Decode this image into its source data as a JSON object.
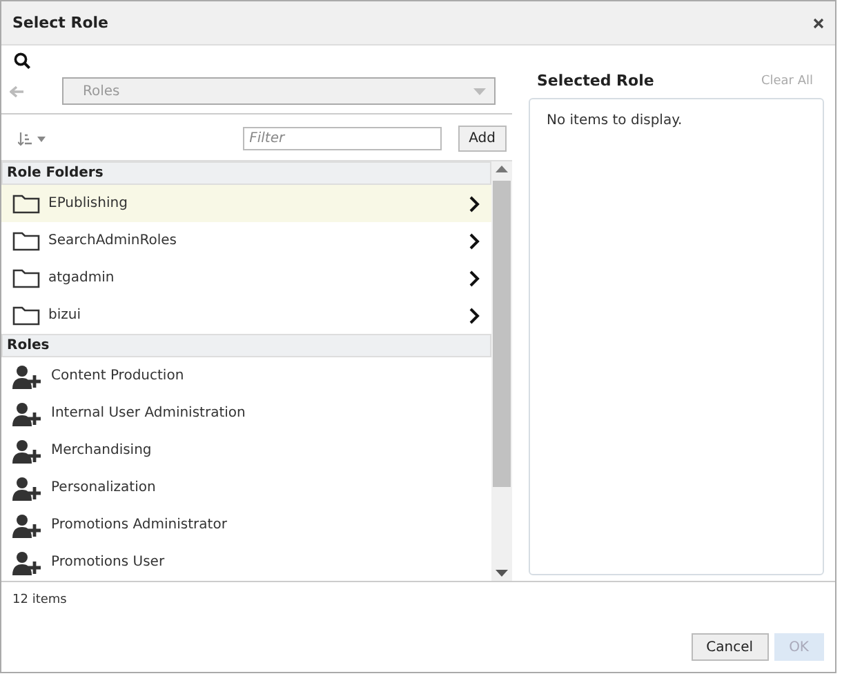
{
  "window": {
    "title": "Select Role"
  },
  "breadcrumb": {
    "value": "Roles",
    "back_disabled": true
  },
  "filter": {
    "placeholder": "Filter"
  },
  "add_button": "Add",
  "sections": [
    {
      "title": "Role Folders",
      "kind": "folder",
      "items": [
        {
          "label": "EPublishing",
          "selected": true
        },
        {
          "label": "SearchAdminRoles",
          "selected": false
        },
        {
          "label": "atgadmin",
          "selected": false
        },
        {
          "label": "bizui",
          "selected": false
        }
      ]
    },
    {
      "title": "Roles",
      "kind": "role",
      "items": [
        {
          "label": "Content Production",
          "selected": false
        },
        {
          "label": "Internal User Administration",
          "selected": false
        },
        {
          "label": "Merchandising",
          "selected": false
        },
        {
          "label": "Personalization",
          "selected": false
        },
        {
          "label": "Promotions Administrator",
          "selected": false
        },
        {
          "label": "Promotions User",
          "selected": false
        }
      ]
    }
  ],
  "selected_panel": {
    "title": "Selected Role",
    "clear_all": {
      "label": "Clear All",
      "disabled": true
    },
    "empty_text": "No items to display."
  },
  "status": "12 items",
  "buttons": [
    {
      "label": "Cancel",
      "disabled": false
    },
    {
      "label": "OK",
      "disabled": true
    }
  ]
}
